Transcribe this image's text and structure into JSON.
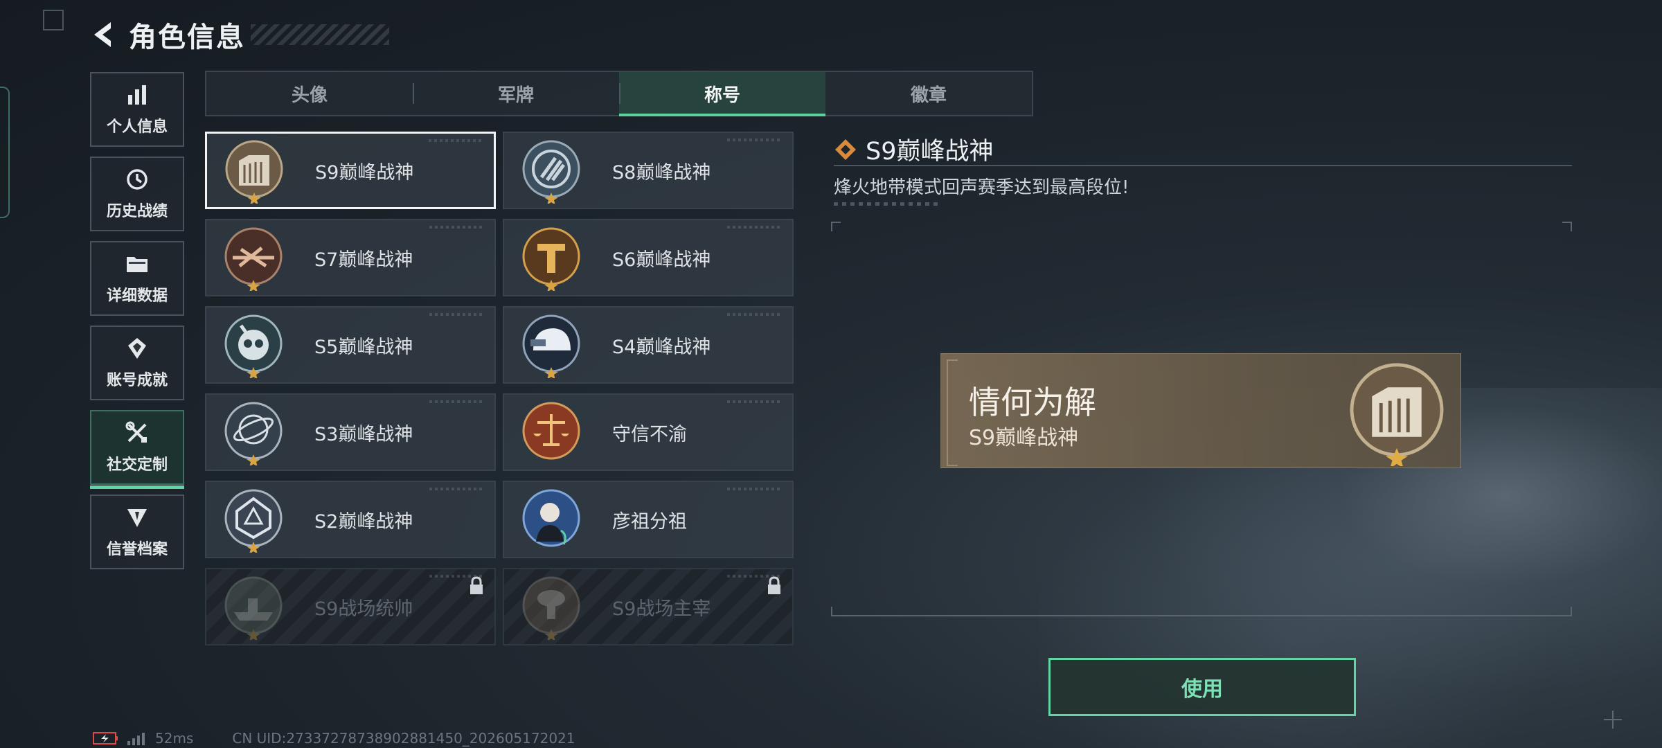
{
  "header": {
    "title": "角色信息"
  },
  "sidebar": {
    "items": [
      {
        "label": "个人信息",
        "icon": "bar-chart-icon"
      },
      {
        "label": "历史战绩",
        "icon": "clock-history-icon"
      },
      {
        "label": "详细数据",
        "icon": "folder-icon"
      },
      {
        "label": "账号成就",
        "icon": "achievement-icon"
      },
      {
        "label": "社交定制",
        "icon": "tools-icon",
        "active": true
      },
      {
        "label": "信誉档案",
        "icon": "shield-icon"
      }
    ]
  },
  "tabs": [
    {
      "label": "头像"
    },
    {
      "label": "军牌"
    },
    {
      "label": "称号",
      "active": true
    },
    {
      "label": "徽章"
    }
  ],
  "titles": [
    {
      "label": "S9巅峰战神",
      "selected": true
    },
    {
      "label": "S8巅峰战神"
    },
    {
      "label": "S7巅峰战神"
    },
    {
      "label": "S6巅峰战神"
    },
    {
      "label": "S5巅峰战神"
    },
    {
      "label": "S4巅峰战神"
    },
    {
      "label": "S3巅峰战神"
    },
    {
      "label": "守信不渝"
    },
    {
      "label": "S2巅峰战神"
    },
    {
      "label": "彦祖分祖"
    },
    {
      "label": "S9战场统帅",
      "locked": true
    },
    {
      "label": "S9战场主宰",
      "locked": true
    }
  ],
  "detail": {
    "title": "S9巅峰战神",
    "description": "烽火地带模式回声赛季达到最高段位!",
    "preview_name": "情何为解",
    "preview_title": "S9巅峰战神"
  },
  "use_button": {
    "label": "使用"
  },
  "status": {
    "ping": "52ms",
    "uid": "CN UID:27337278738902881450_202605172021"
  },
  "colors": {
    "accent": "#62d5a4",
    "gold": "#d9a441",
    "lock": "#cfd4d8"
  }
}
